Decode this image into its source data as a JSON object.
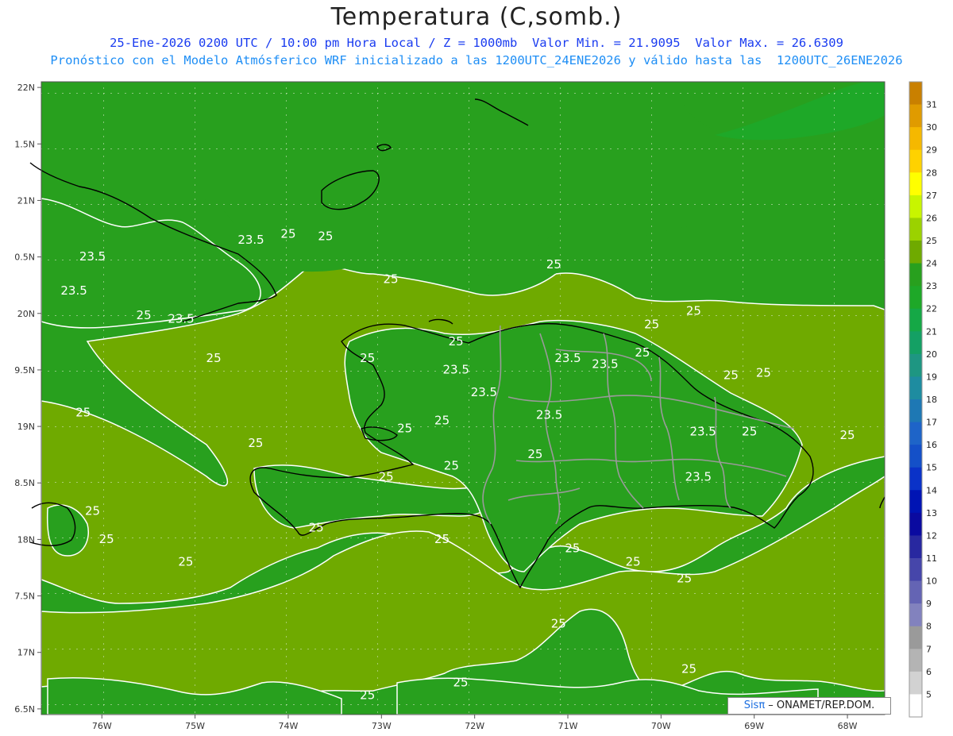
{
  "title": "Temperatura (C,somb.)",
  "subtitle_line1": "25-Ene-2026 0200 UTC / 10:00 pm Hora Local / Z = 1000mb  Valor Min. = 21.9095  Valor Max. = 26.6309",
  "subtitle_line2": "Pronóstico con el Modelo Atmósferico WRF inicializado a las 1200UTC_24ENE2026 y válido hasta las  1200UTC_26ENE2026",
  "credit": {
    "brand": "Sisπ",
    "text": " – ONAMET/REP.DOM."
  },
  "map": {
    "lon_range": [
      -76.65,
      -67.6
    ],
    "lat_range": [
      16.45,
      22.05
    ],
    "x_ticks": [
      "76W",
      "75W",
      "74W",
      "73W",
      "72W",
      "71W",
      "70W",
      "69W",
      "68W"
    ],
    "y_ticks": [
      "22N",
      "1.5N",
      "21N",
      "0.5N",
      "20N",
      "9.5N",
      "19N",
      "8.5N",
      "18N",
      "7.5N",
      "17N",
      "6.5N"
    ],
    "contour_labels": [
      {
        "text": "23.5",
        "lon": -76.1,
        "lat": 20.5
      },
      {
        "text": "23.5",
        "lon": -74.4,
        "lat": 20.65
      },
      {
        "text": "25",
        "lon": -74.0,
        "lat": 20.7
      },
      {
        "text": "25",
        "lon": -73.6,
        "lat": 20.68
      },
      {
        "text": "23.5",
        "lon": -76.3,
        "lat": 20.2
      },
      {
        "text": "25",
        "lon": -75.55,
        "lat": 19.98
      },
      {
        "text": "23.5",
        "lon": -75.15,
        "lat": 19.95
      },
      {
        "text": "25",
        "lon": -74.8,
        "lat": 19.6
      },
      {
        "text": "25",
        "lon": -72.9,
        "lat": 20.3
      },
      {
        "text": "25",
        "lon": -72.2,
        "lat": 19.75
      },
      {
        "text": "23.5",
        "lon": -72.2,
        "lat": 19.5
      },
      {
        "text": "25",
        "lon": -73.15,
        "lat": 19.6
      },
      {
        "text": "23.5",
        "lon": -71.9,
        "lat": 19.3
      },
      {
        "text": "25",
        "lon": -71.15,
        "lat": 20.43
      },
      {
        "text": "23.5",
        "lon": -71.0,
        "lat": 19.6
      },
      {
        "text": "23.5",
        "lon": -70.6,
        "lat": 19.55
      },
      {
        "text": "25",
        "lon": -70.1,
        "lat": 19.9
      },
      {
        "text": "25",
        "lon": -70.2,
        "lat": 19.65
      },
      {
        "text": "25",
        "lon": -69.65,
        "lat": 20.02
      },
      {
        "text": "25",
        "lon": -69.25,
        "lat": 19.45
      },
      {
        "text": "25",
        "lon": -68.9,
        "lat": 19.47
      },
      {
        "text": "23.5",
        "lon": -71.2,
        "lat": 19.1
      },
      {
        "text": "23.5",
        "lon": -69.55,
        "lat": 18.95
      },
      {
        "text": "25",
        "lon": -69.05,
        "lat": 18.95
      },
      {
        "text": "25",
        "lon": -68.0,
        "lat": 18.92
      },
      {
        "text": "25",
        "lon": -76.2,
        "lat": 19.12
      },
      {
        "text": "25",
        "lon": -74.35,
        "lat": 18.85
      },
      {
        "text": "25",
        "lon": -72.75,
        "lat": 18.98
      },
      {
        "text": "25",
        "lon": -72.35,
        "lat": 19.05
      },
      {
        "text": "25",
        "lon": -72.25,
        "lat": 18.65
      },
      {
        "text": "25",
        "lon": -72.95,
        "lat": 18.55
      },
      {
        "text": "25",
        "lon": -71.35,
        "lat": 18.75
      },
      {
        "text": "23.5",
        "lon": -69.6,
        "lat": 18.55
      },
      {
        "text": "25",
        "lon": -76.1,
        "lat": 18.25
      },
      {
        "text": "25",
        "lon": -75.95,
        "lat": 18.0
      },
      {
        "text": "25",
        "lon": -73.7,
        "lat": 18.1
      },
      {
        "text": "25",
        "lon": -72.35,
        "lat": 18.0
      },
      {
        "text": "25",
        "lon": -70.95,
        "lat": 17.92
      },
      {
        "text": "25",
        "lon": -70.3,
        "lat": 17.8
      },
      {
        "text": "25",
        "lon": -69.75,
        "lat": 17.65
      },
      {
        "text": "25",
        "lon": -75.1,
        "lat": 17.8
      },
      {
        "text": "25",
        "lon": -71.1,
        "lat": 17.25
      },
      {
        "text": "25",
        "lon": -72.15,
        "lat": 16.73
      },
      {
        "text": "25",
        "lon": -73.15,
        "lat": 16.62
      },
      {
        "text": "25",
        "lon": -69.7,
        "lat": 16.85
      }
    ]
  },
  "colorbar": {
    "labels": [
      "31",
      "30",
      "29",
      "28",
      "27",
      "26",
      "25",
      "24",
      "23",
      "22",
      "21",
      "20",
      "19",
      "18",
      "17",
      "16",
      "15",
      "14",
      "13",
      "12",
      "11",
      "10",
      "9",
      "8",
      "7",
      "6",
      "5"
    ],
    "colors": [
      "#c98000",
      "#e09b00",
      "#f5b800",
      "#ffd200",
      "#ffff00",
      "#c8f500",
      "#9bd200",
      "#6faa00",
      "#28a01e",
      "#1ea828",
      "#15a846",
      "#14a064",
      "#1e9682",
      "#1e8ca0",
      "#1e78b4",
      "#1e64c8",
      "#1450c8",
      "#0a32c8",
      "#0014b4",
      "#0a0aa0",
      "#2828a0",
      "#4646aa",
      "#6464b4",
      "#8282be",
      "#9a9a9a",
      "#b4b4b4",
      "#d2d2d2",
      "#ffffff"
    ]
  },
  "field_colors": {
    "band_25_26": "#6faa00",
    "band_24_25": "#28a01e",
    "band_23_24": "#1ea828",
    "contour": "#ffffff",
    "coastline": "#000000",
    "boundary": "#9a9a9a"
  }
}
